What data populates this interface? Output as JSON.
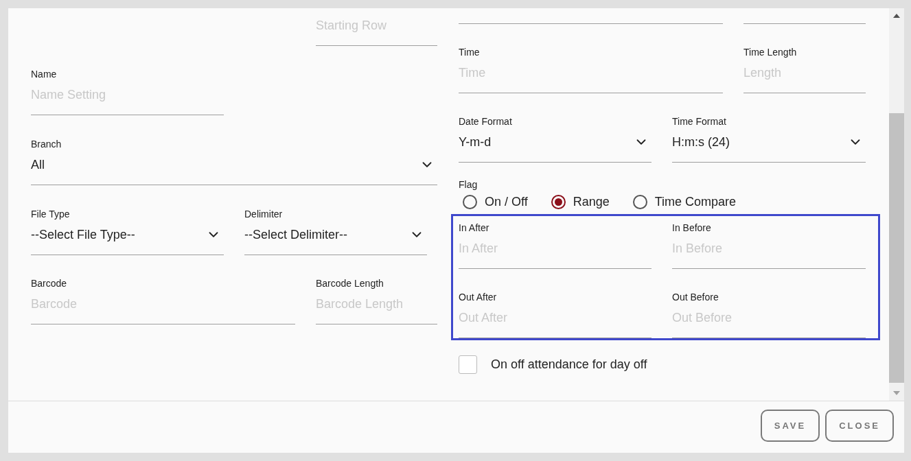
{
  "starting_row": {
    "placeholder": "Starting Row"
  },
  "name": {
    "label": "Name",
    "placeholder": "Name Setting"
  },
  "branch": {
    "label": "Branch",
    "value": "All"
  },
  "file_type": {
    "label": "File Type",
    "value": "--Select File Type--"
  },
  "delimiter": {
    "label": "Delimiter",
    "value": "--Select Delimiter--"
  },
  "barcode": {
    "label": "Barcode",
    "placeholder": "Barcode"
  },
  "barcode_length": {
    "label": "Barcode Length",
    "placeholder": "Barcode Length"
  },
  "time": {
    "label": "Time",
    "placeholder": "Time"
  },
  "time_length": {
    "label": "Time Length",
    "placeholder": "Length"
  },
  "date_format": {
    "label": "Date Format",
    "value": "Y-m-d"
  },
  "time_format": {
    "label": "Time Format",
    "value": "H:m:s (24)"
  },
  "flag": {
    "label": "Flag",
    "options": [
      {
        "label": "On / Off",
        "selected": false
      },
      {
        "label": "Range",
        "selected": true
      },
      {
        "label": "Time Compare",
        "selected": false
      }
    ]
  },
  "range": {
    "fields": [
      {
        "label": "In After",
        "placeholder": "In After"
      },
      {
        "label": "In Before",
        "placeholder": "In Before"
      },
      {
        "label": "Out After",
        "placeholder": "Out After"
      },
      {
        "label": "Out Before",
        "placeholder": "Out Before"
      }
    ]
  },
  "day_off": {
    "label": "On off attendance for day off",
    "checked": false
  },
  "buttons": [
    {
      "label": "SAVE"
    },
    {
      "label": "CLOSE"
    }
  ]
}
